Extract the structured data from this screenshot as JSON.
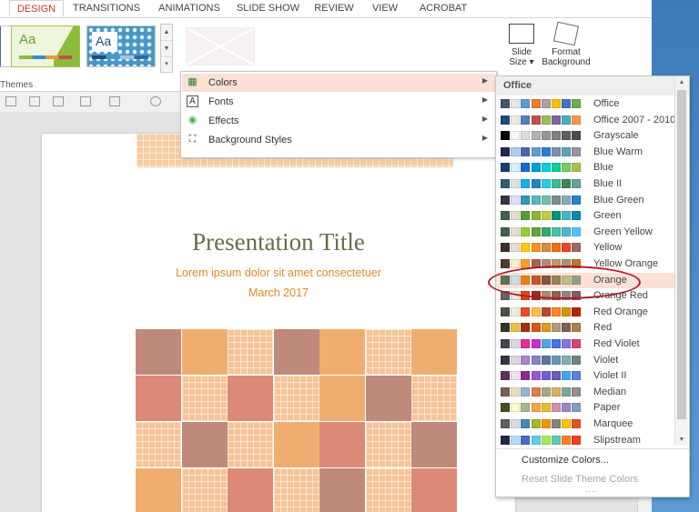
{
  "ribbon": {
    "tabs": [
      {
        "label": "DESIGN",
        "active": true
      },
      {
        "label": "TRANSITIONS",
        "active": false
      },
      {
        "label": "ANIMATIONS",
        "active": false
      },
      {
        "label": "SLIDE SHOW",
        "active": false
      },
      {
        "label": "REVIEW",
        "active": false
      },
      {
        "label": "VIEW",
        "active": false
      },
      {
        "label": "ACROBAT",
        "active": false
      }
    ],
    "themes_label": "Themes",
    "theme_thumb_text": "Aa",
    "slide_size": {
      "line1": "Slide",
      "line2": "Size ▾"
    },
    "format_background": {
      "line1": "Format",
      "line2": "Background"
    }
  },
  "design_menu": {
    "items": [
      {
        "label": "Colors",
        "icon": "colors-icon",
        "highlighted": true
      },
      {
        "label": "Fonts",
        "icon": "fonts-icon",
        "highlighted": false
      },
      {
        "label": "Effects",
        "icon": "effects-icon",
        "highlighted": false
      },
      {
        "label": "Background Styles",
        "icon": "background-styles-icon",
        "highlighted": false
      }
    ]
  },
  "colors_menu": {
    "header": "Office",
    "selected": "Orange",
    "themes": [
      {
        "name": "Office",
        "colors": [
          "#44546a",
          "#e7e6e6",
          "#5b9bd5",
          "#ed7d31",
          "#a5a5a5",
          "#ffc000",
          "#4472c4",
          "#70ad47"
        ]
      },
      {
        "name": "Office 2007 - 2010",
        "colors": [
          "#1f497d",
          "#eeece1",
          "#4f81bd",
          "#c0504d",
          "#9bbb59",
          "#8064a2",
          "#4bacc6",
          "#f79646"
        ]
      },
      {
        "name": "Grayscale",
        "colors": [
          "#000000",
          "#f8f8f8",
          "#dddddd",
          "#b2b2b2",
          "#969696",
          "#808080",
          "#5f5f5f",
          "#4d4d4d"
        ]
      },
      {
        "name": "Blue Warm",
        "colors": [
          "#242852",
          "#acccea",
          "#4a66ac",
          "#629dd1",
          "#297fd5",
          "#7f8fa9",
          "#5aa2ae",
          "#9d90a0"
        ]
      },
      {
        "name": "Blue",
        "colors": [
          "#17406d",
          "#dbeff9",
          "#0f6fc6",
          "#009dd9",
          "#0bd0d9",
          "#10cf9b",
          "#7cca62",
          "#a5c249"
        ]
      },
      {
        "name": "Blue II",
        "colors": [
          "#335b74",
          "#dfe3e5",
          "#1cade4",
          "#2683c6",
          "#27ced7",
          "#42ba97",
          "#3e8853",
          "#62a39f"
        ]
      },
      {
        "name": "Blue Green",
        "colors": [
          "#373545",
          "#dedef8",
          "#3494ba",
          "#58b6c0",
          "#75bda7",
          "#7a8c8e",
          "#84acb6",
          "#2683c6"
        ]
      },
      {
        "name": "Green",
        "colors": [
          "#455f51",
          "#e3ded1",
          "#549e39",
          "#8ab833",
          "#c0cf3a",
          "#029676",
          "#4ab5c4",
          "#0989b1"
        ]
      },
      {
        "name": "Green Yellow",
        "colors": [
          "#455f51",
          "#e3ded1",
          "#99cb38",
          "#63a537",
          "#37a76f",
          "#44c1a3",
          "#4eb3cf",
          "#51c3f9"
        ]
      },
      {
        "name": "Yellow",
        "colors": [
          "#39302a",
          "#e5dedb",
          "#ffca08",
          "#f8931d",
          "#ce8d3e",
          "#ec7016",
          "#e64823",
          "#9c6a6a"
        ]
      },
      {
        "name": "Yellow Orange",
        "colors": [
          "#4e3b30",
          "#fbeec9",
          "#f0a22e",
          "#a5644e",
          "#b58b80",
          "#c3986d",
          "#a19574",
          "#c17529"
        ]
      },
      {
        "name": "Orange",
        "colors": [
          "#637052",
          "#ccddea",
          "#e48312",
          "#bd582c",
          "#865640",
          "#9b8357",
          "#c2bc80",
          "#94a088"
        ]
      },
      {
        "name": "Orange Red",
        "colors": [
          "#696464",
          "#e9e5dc",
          "#d34817",
          "#9b2d1f",
          "#a28e6a",
          "#956251",
          "#918485",
          "#855d5d"
        ]
      },
      {
        "name": "Red Orange",
        "colors": [
          "#505046",
          "#eeece1",
          "#e84c22",
          "#ffbd47",
          "#b64926",
          "#ff8427",
          "#cc9900",
          "#b22600"
        ]
      },
      {
        "name": "Red",
        "colors": [
          "#323232",
          "#e5c243",
          "#a5300f",
          "#d55816",
          "#e19825",
          "#b19c7d",
          "#7f5f52",
          "#b27d49"
        ]
      },
      {
        "name": "Red Violet",
        "colors": [
          "#454551",
          "#d8d9dc",
          "#e32d91",
          "#c830cc",
          "#4ea6dc",
          "#4775e7",
          "#8971e1",
          "#d54773"
        ]
      },
      {
        "name": "Violet",
        "colors": [
          "#373545",
          "#dcd8dc",
          "#ad84c6",
          "#8784c7",
          "#5d739a",
          "#6997af",
          "#84acb6",
          "#6f8183"
        ]
      },
      {
        "name": "Violet II",
        "colors": [
          "#632e62",
          "#eae5eb",
          "#92278f",
          "#9b57d3",
          "#755dd9",
          "#665eb8",
          "#45a5ed",
          "#5982db"
        ]
      },
      {
        "name": "Median",
        "colors": [
          "#775f55",
          "#ebddc3",
          "#94b6d2",
          "#dd8047",
          "#a5ab81",
          "#d8b25c",
          "#7ba79d",
          "#968c8c"
        ]
      },
      {
        "name": "Paper",
        "colors": [
          "#444d26",
          "#fefac9",
          "#a5b592",
          "#f3a447",
          "#e7bc29",
          "#d092a7",
          "#9c85c0",
          "#809ec2"
        ]
      },
      {
        "name": "Marquee",
        "colors": [
          "#5e5e5e",
          "#dddddd",
          "#418ab3",
          "#a6b727",
          "#f69200",
          "#838383",
          "#fec306",
          "#df5327"
        ]
      },
      {
        "name": "Slipstream",
        "colors": [
          "#212745",
          "#b4dcfa",
          "#4e67c8",
          "#5eccf3",
          "#a7ea52",
          "#5dceaf",
          "#ff8021",
          "#f14124"
        ]
      }
    ],
    "customize_label": "Customize Colors...",
    "reset_label": "Reset Slide Theme Colors"
  },
  "slide": {
    "title": "Presentation Title",
    "subtitle": "Lorem ipsum dolor sit amet consectetuer",
    "date": "March 2017",
    "palette": [
      "#bf8a7b",
      "#f0ad70",
      "#dc8a77",
      "#f6c497"
    ]
  }
}
